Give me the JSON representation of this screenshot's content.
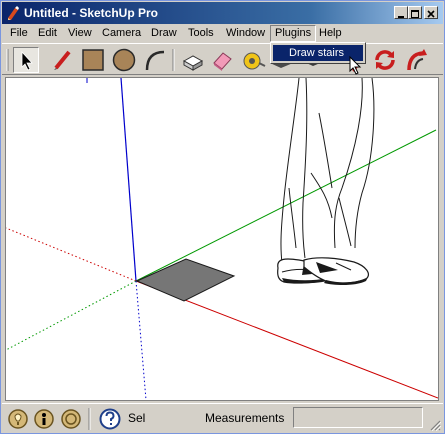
{
  "window": {
    "title": "Untitled - SketchUp Pro"
  },
  "menubar": {
    "items": [
      "File",
      "Edit",
      "View",
      "Camera",
      "Draw",
      "Tools",
      "Window",
      "Plugins",
      "Help"
    ],
    "open_item": "Plugins"
  },
  "plugins_menu": {
    "items": [
      {
        "label": "Draw stairs",
        "highlighted": true
      }
    ]
  },
  "toolbar": {
    "tools": [
      "select-icon",
      "pencil-icon",
      "rectangle-icon",
      "circle-icon",
      "arc-icon",
      "eraser-icon",
      "paint-bucket-icon",
      "tape-measure-icon",
      "push-pull-icon",
      "move-icon",
      "rotate-icon",
      "follow-me-icon"
    ],
    "active_tool": "select-icon"
  },
  "status": {
    "sel_label": "Sel",
    "measurements_label": "Measurements",
    "measurements_value": ""
  },
  "colors": {
    "title_bar": "#0a246a",
    "menu_highlight": "#0a246a",
    "axis_red": "#cc0000",
    "axis_green": "#009900",
    "axis_blue": "#0000cc",
    "face_gray": "#767676"
  }
}
